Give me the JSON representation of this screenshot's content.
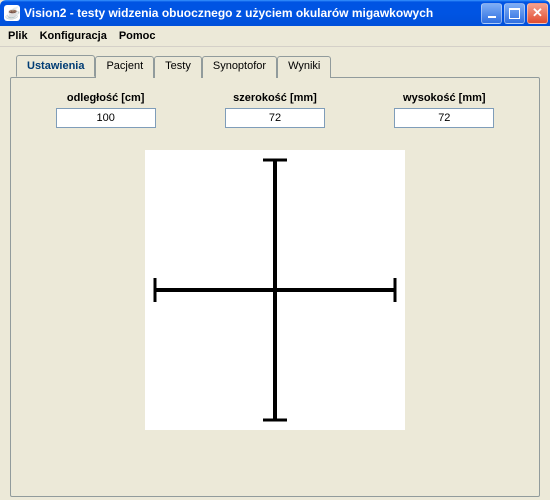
{
  "window": {
    "title": "Vision2 - testy widzenia obuocznego z użyciem okularów migawkowych",
    "icon": "java-icon"
  },
  "menubar": {
    "items": [
      "Plik",
      "Konfiguracja",
      "Pomoc"
    ]
  },
  "tabs": {
    "items": [
      {
        "label": "Ustawienia",
        "active": true
      },
      {
        "label": "Pacjent",
        "active": false
      },
      {
        "label": "Testy",
        "active": false
      },
      {
        "label": "Synoptofor",
        "active": false
      },
      {
        "label": "Wyniki",
        "active": false
      }
    ]
  },
  "settings": {
    "distance": {
      "label": "odległość [cm]",
      "value": "100"
    },
    "width": {
      "label": "szerokość [mm]",
      "value": "72"
    },
    "height": {
      "label": "wysokość [mm]",
      "value": "72"
    }
  }
}
